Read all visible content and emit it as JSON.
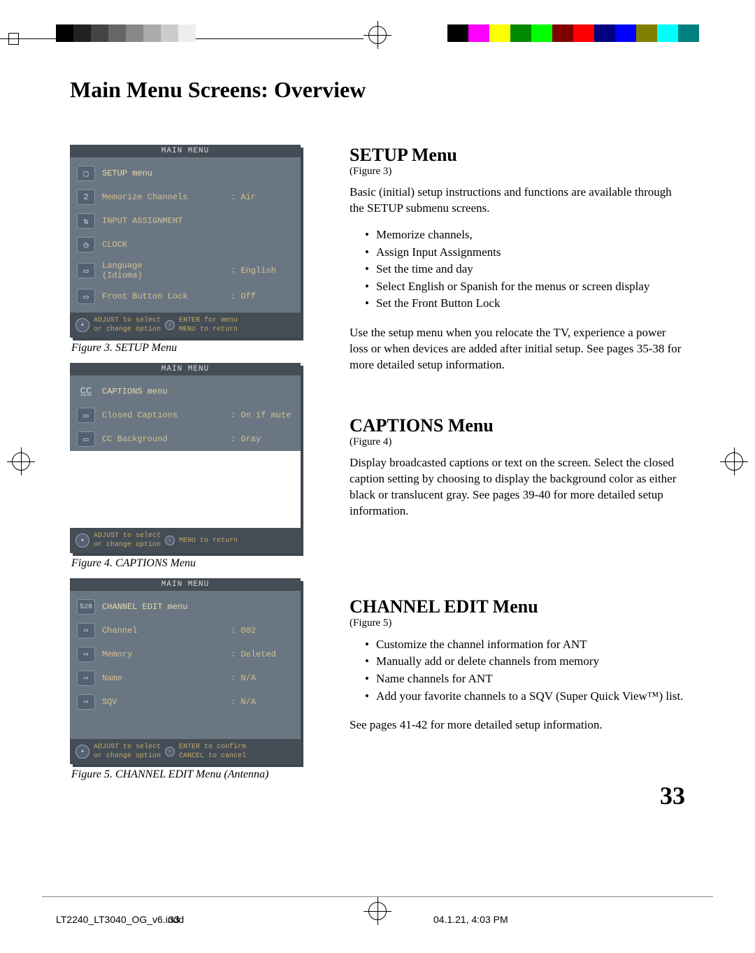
{
  "page": {
    "title": "Main Menu Screens: Overview",
    "number": "33"
  },
  "figures": {
    "fig3": {
      "caption": "Figure 3.  SETUP Menu",
      "osd_title": "MAIN MENU",
      "rows": [
        {
          "label": "SETUP menu",
          "value": ""
        },
        {
          "label": "Memorize Channels",
          "value": ": Air"
        },
        {
          "label": "INPUT ASSIGNMENT",
          "value": ""
        },
        {
          "label": "CLOCK",
          "value": ""
        },
        {
          "label": "Language\n(Idioma)",
          "value": ": English"
        },
        {
          "label": "Front Button Lock",
          "value": ": Off"
        }
      ],
      "footer_left": "ADJUST to select",
      "footer_left2": "or change option",
      "footer_right": "ENTER for menu",
      "footer_right2": "MENU to return"
    },
    "fig4": {
      "caption": "Figure 4.  CAPTIONS Menu",
      "osd_title": "MAIN MENU",
      "rows": [
        {
          "label": "CAPTIONS menu",
          "value": ""
        },
        {
          "label": "Closed Captions",
          "value": ": On if mute"
        },
        {
          "label": "CC Background",
          "value": ": Gray"
        }
      ],
      "footer_left": "ADJUST to select",
      "footer_left2": "or change option",
      "footer_right2": "MENU to return"
    },
    "fig5": {
      "caption": "Figure 5.  CHANNEL EDIT Menu (Antenna)",
      "osd_title": "MAIN MENU",
      "rows": [
        {
          "label": "CHANNEL EDIT menu",
          "value": ""
        },
        {
          "label": "Channel",
          "value": ": 002"
        },
        {
          "label": "Memory",
          "value": ": Deleted"
        },
        {
          "label": "Name",
          "value": ": N/A"
        },
        {
          "label": "SQV",
          "value": ": N/A"
        }
      ],
      "footer_left": "ADJUST to select",
      "footer_left2": "or change option",
      "footer_right": "ENTER to confirm",
      "footer_right2": "CANCEL to cancel"
    }
  },
  "sections": {
    "setup": {
      "heading": "SETUP Menu",
      "figref": "(Figure 3)",
      "para1": "Basic (initial) setup instructions and functions are available through the SETUP submenu screens.",
      "bullets": [
        "Memorize channels,",
        "Assign Input Assignments",
        "Set the time and day",
        "Select English or Spanish for the menus or screen display",
        "Set the Front Button Lock"
      ],
      "para2": "Use the setup menu when you relocate the TV, experience a power loss or when devices are added after initial setup.  See pages 35-38 for more detailed setup information."
    },
    "captions": {
      "heading": "CAPTIONS Menu",
      "figref": "(Figure 4)",
      "para1": "Display broadcasted captions or text on the screen.  Select the closed caption setting by choosing to display the background color as either black or translucent gray.  See pages 39-40 for more detailed setup information."
    },
    "channel": {
      "heading": "CHANNEL EDIT Menu",
      "figref": "(Figure 5)",
      "bullets": [
        "Customize the channel information for ANT",
        "Manually add or delete channels from memory",
        "Name channels for ANT",
        "Add your favorite channels to a SQV (Super Quick View™) list."
      ],
      "para2": "See pages 41-42 for more detailed setup information."
    }
  },
  "docfoot": {
    "filename": "LT2240_LT3040_OG_v6.indd",
    "pageinline": "33",
    "timestamp": "04.1.21, 4:03 PM"
  }
}
